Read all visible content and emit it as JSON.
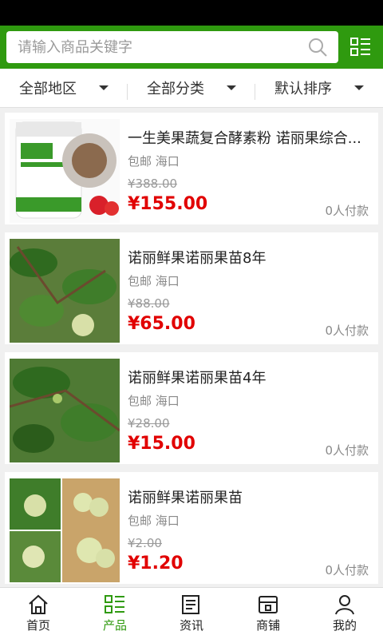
{
  "search": {
    "placeholder": "请输入商品关键字"
  },
  "filters": [
    {
      "label": "全部地区"
    },
    {
      "label": "全部分类"
    },
    {
      "label": "默认排序"
    }
  ],
  "products": [
    {
      "title": "一生美果蔬复合酵素粉 诺丽果综合...",
      "meta": "包邮 海口",
      "old_price": "¥388.00",
      "price": "¥155.00",
      "paid": "0人付款"
    },
    {
      "title": "诺丽鲜果诺丽果苗8年",
      "meta": "包邮 海口",
      "old_price": "¥88.00",
      "price": "¥65.00",
      "paid": "0人付款"
    },
    {
      "title": "诺丽鲜果诺丽果苗4年",
      "meta": "包邮 海口",
      "old_price": "¥28.00",
      "price": "¥15.00",
      "paid": "0人付款"
    },
    {
      "title": "诺丽鲜果诺丽果苗",
      "meta": "包邮 海口",
      "old_price": "¥2.00",
      "price": "¥1.20",
      "paid": "0人付款"
    }
  ],
  "nav": [
    {
      "label": "首页",
      "icon": "home-icon"
    },
    {
      "label": "产品",
      "icon": "product-list-icon"
    },
    {
      "label": "资讯",
      "icon": "news-icon"
    },
    {
      "label": "商铺",
      "icon": "shop-icon"
    },
    {
      "label": "我的",
      "icon": "user-icon"
    }
  ],
  "colors": {
    "brand": "#2f9a0f",
    "price": "#e10000"
  }
}
